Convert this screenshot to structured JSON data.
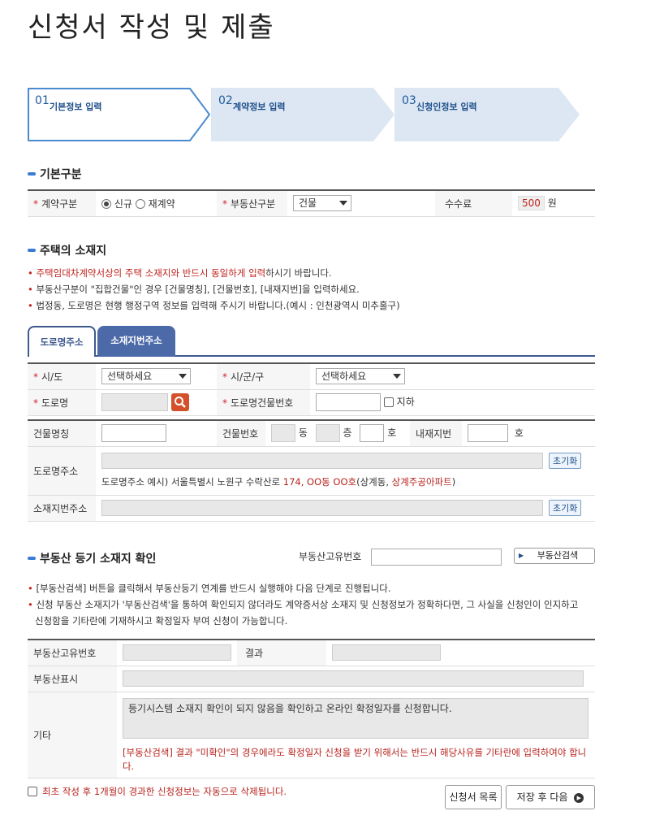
{
  "page_title": "신청서 작성 및 제출",
  "steps": [
    {
      "num": "01",
      "label": "기본정보 입력"
    },
    {
      "num": "02",
      "label": "계약정보 입력"
    },
    {
      "num": "03",
      "label": "신청인정보 입력"
    }
  ],
  "basic": {
    "title": "기본구분",
    "contract_label": "계약구분",
    "opt_new": "신규",
    "opt_renew": "재계약",
    "property_label": "부동산구분",
    "property_value": "건물",
    "fee_label": "수수료",
    "fee_value": "500",
    "fee_unit": "원"
  },
  "location": {
    "title": "주택의 소재지",
    "note1_red": "주택임대차계약서상의 주택 소재지와 반드시 동일하게 입력",
    "note1_rest": "하시기 바랍니다.",
    "note2": "부동산구분이 \"집합건물\"인 경우 [건물명칭], [건물번호], [내재지번]을 입력하세요.",
    "note3": "법정동, 도로명은 현행 행정구역 정보를 입력해 주시기 바랍니다.(예시 : 인천광역시 미추홀구)",
    "tab_road": "도로명주소",
    "tab_lot": "소재지번주소",
    "sido_label": "시/도",
    "sido_value": "선택하세요",
    "sigungu_label": "시/군/구",
    "sigungu_value": "선택하세요",
    "road_label": "도로명",
    "road_bldg_label": "도로명건물번호",
    "basement_label": "지하",
    "bldg_name_label": "건물명칭",
    "bldg_no_label": "건물번호",
    "dong": "동",
    "floor": "층",
    "ho": "호",
    "inner_lot_label": "내재지번",
    "inner_ho": "호",
    "road_addr_label": "도로명주소",
    "reset": "초기화",
    "example_prefix": "도로명주소 예시) 서울특별시 노원구 수락산로 ",
    "example_red1": "174, OO동 OO호",
    "example_mid": "(상계동, ",
    "example_red2": "상계주공아파트",
    "example_suffix": ")",
    "lot_addr_label": "소재지번주소",
    "reset2": "초기화"
  },
  "registry": {
    "title": "부동산 등기 소재지 확인",
    "id_label": "부동산고유번호",
    "search_btn": "부동산검색",
    "note1": "[부동산검색] 버튼을 클릭해서 부동산등기 연계를 반드시 실행해야 다음 단계로 진행됩니다.",
    "note2a": "신청 부동산 소재지가 '부동산검색'을 통하여 확인되지 않더라도 계약증서상 소재지 및 신청정보가 정확하다면, 그 사실을 신청인이 인지하고",
    "note2b": "신청함을 기타란에 기재하시고 확정일자 부여 신청이 가능합니다.",
    "row_id_label": "부동산고유번호",
    "result_label": "결과",
    "display_label": "부동산표시",
    "etc_label": "기타",
    "etc_text": "등기시스템 소재지 확인이 되지 않음을 확인하고 온라인 확정일자를 신청합니다.",
    "etc_warn": "[부동산검색] 결과 \"미확인\"의 경우에라도 확정일자 신청을 받기 위해서는 반드시 해당사유를 기타란에 입력하여야 합니다."
  },
  "footer": {
    "delete_notice": "최초 작성 후 1개월이 경과한 신청정보는 자동으로 삭제됩니다.",
    "list_btn": "신청서 목록",
    "next_btn": "저장 후 다음"
  }
}
